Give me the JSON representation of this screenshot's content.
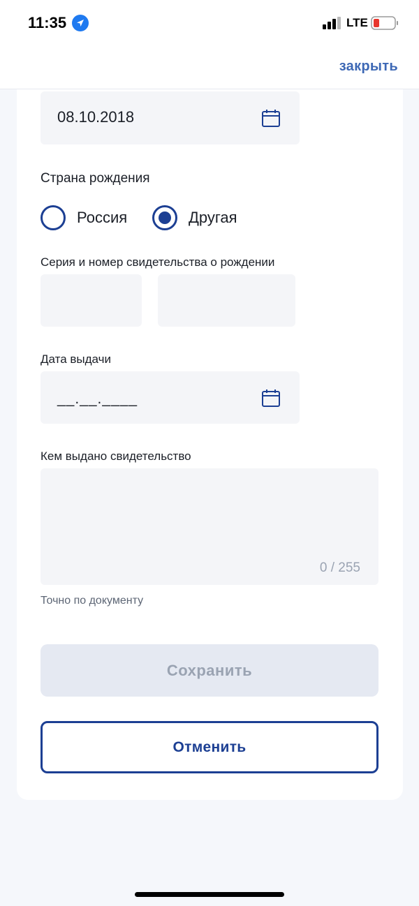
{
  "status_bar": {
    "time": "11:35",
    "network": "LTE",
    "icons": [
      "location-arrow-icon",
      "signal-icon",
      "battery-low-icon"
    ]
  },
  "header": {
    "close_label": "закрыть"
  },
  "form": {
    "birth_date": {
      "value": "08.10.2018"
    },
    "birth_country": {
      "label": "Страна рождения",
      "options": [
        "Россия",
        "Другая"
      ],
      "selected": "Другая"
    },
    "certificate_number": {
      "label": "Серия и номер свидетельства о рождении",
      "series_value": "",
      "number_value": ""
    },
    "issue_date": {
      "label": "Дата выдачи",
      "placeholder": "__.__.____"
    },
    "issued_by": {
      "label": "Кем выдано свидетельство",
      "counter": "0 / 255",
      "hint": "Точно по документу"
    }
  },
  "actions": {
    "save_label": "Сохранить",
    "cancel_label": "Отменить"
  },
  "colors": {
    "accent": "#1c3f93",
    "link": "#3d68b5",
    "field_bg": "#f4f5f8",
    "disabled_btn": "#e5e9f2"
  }
}
